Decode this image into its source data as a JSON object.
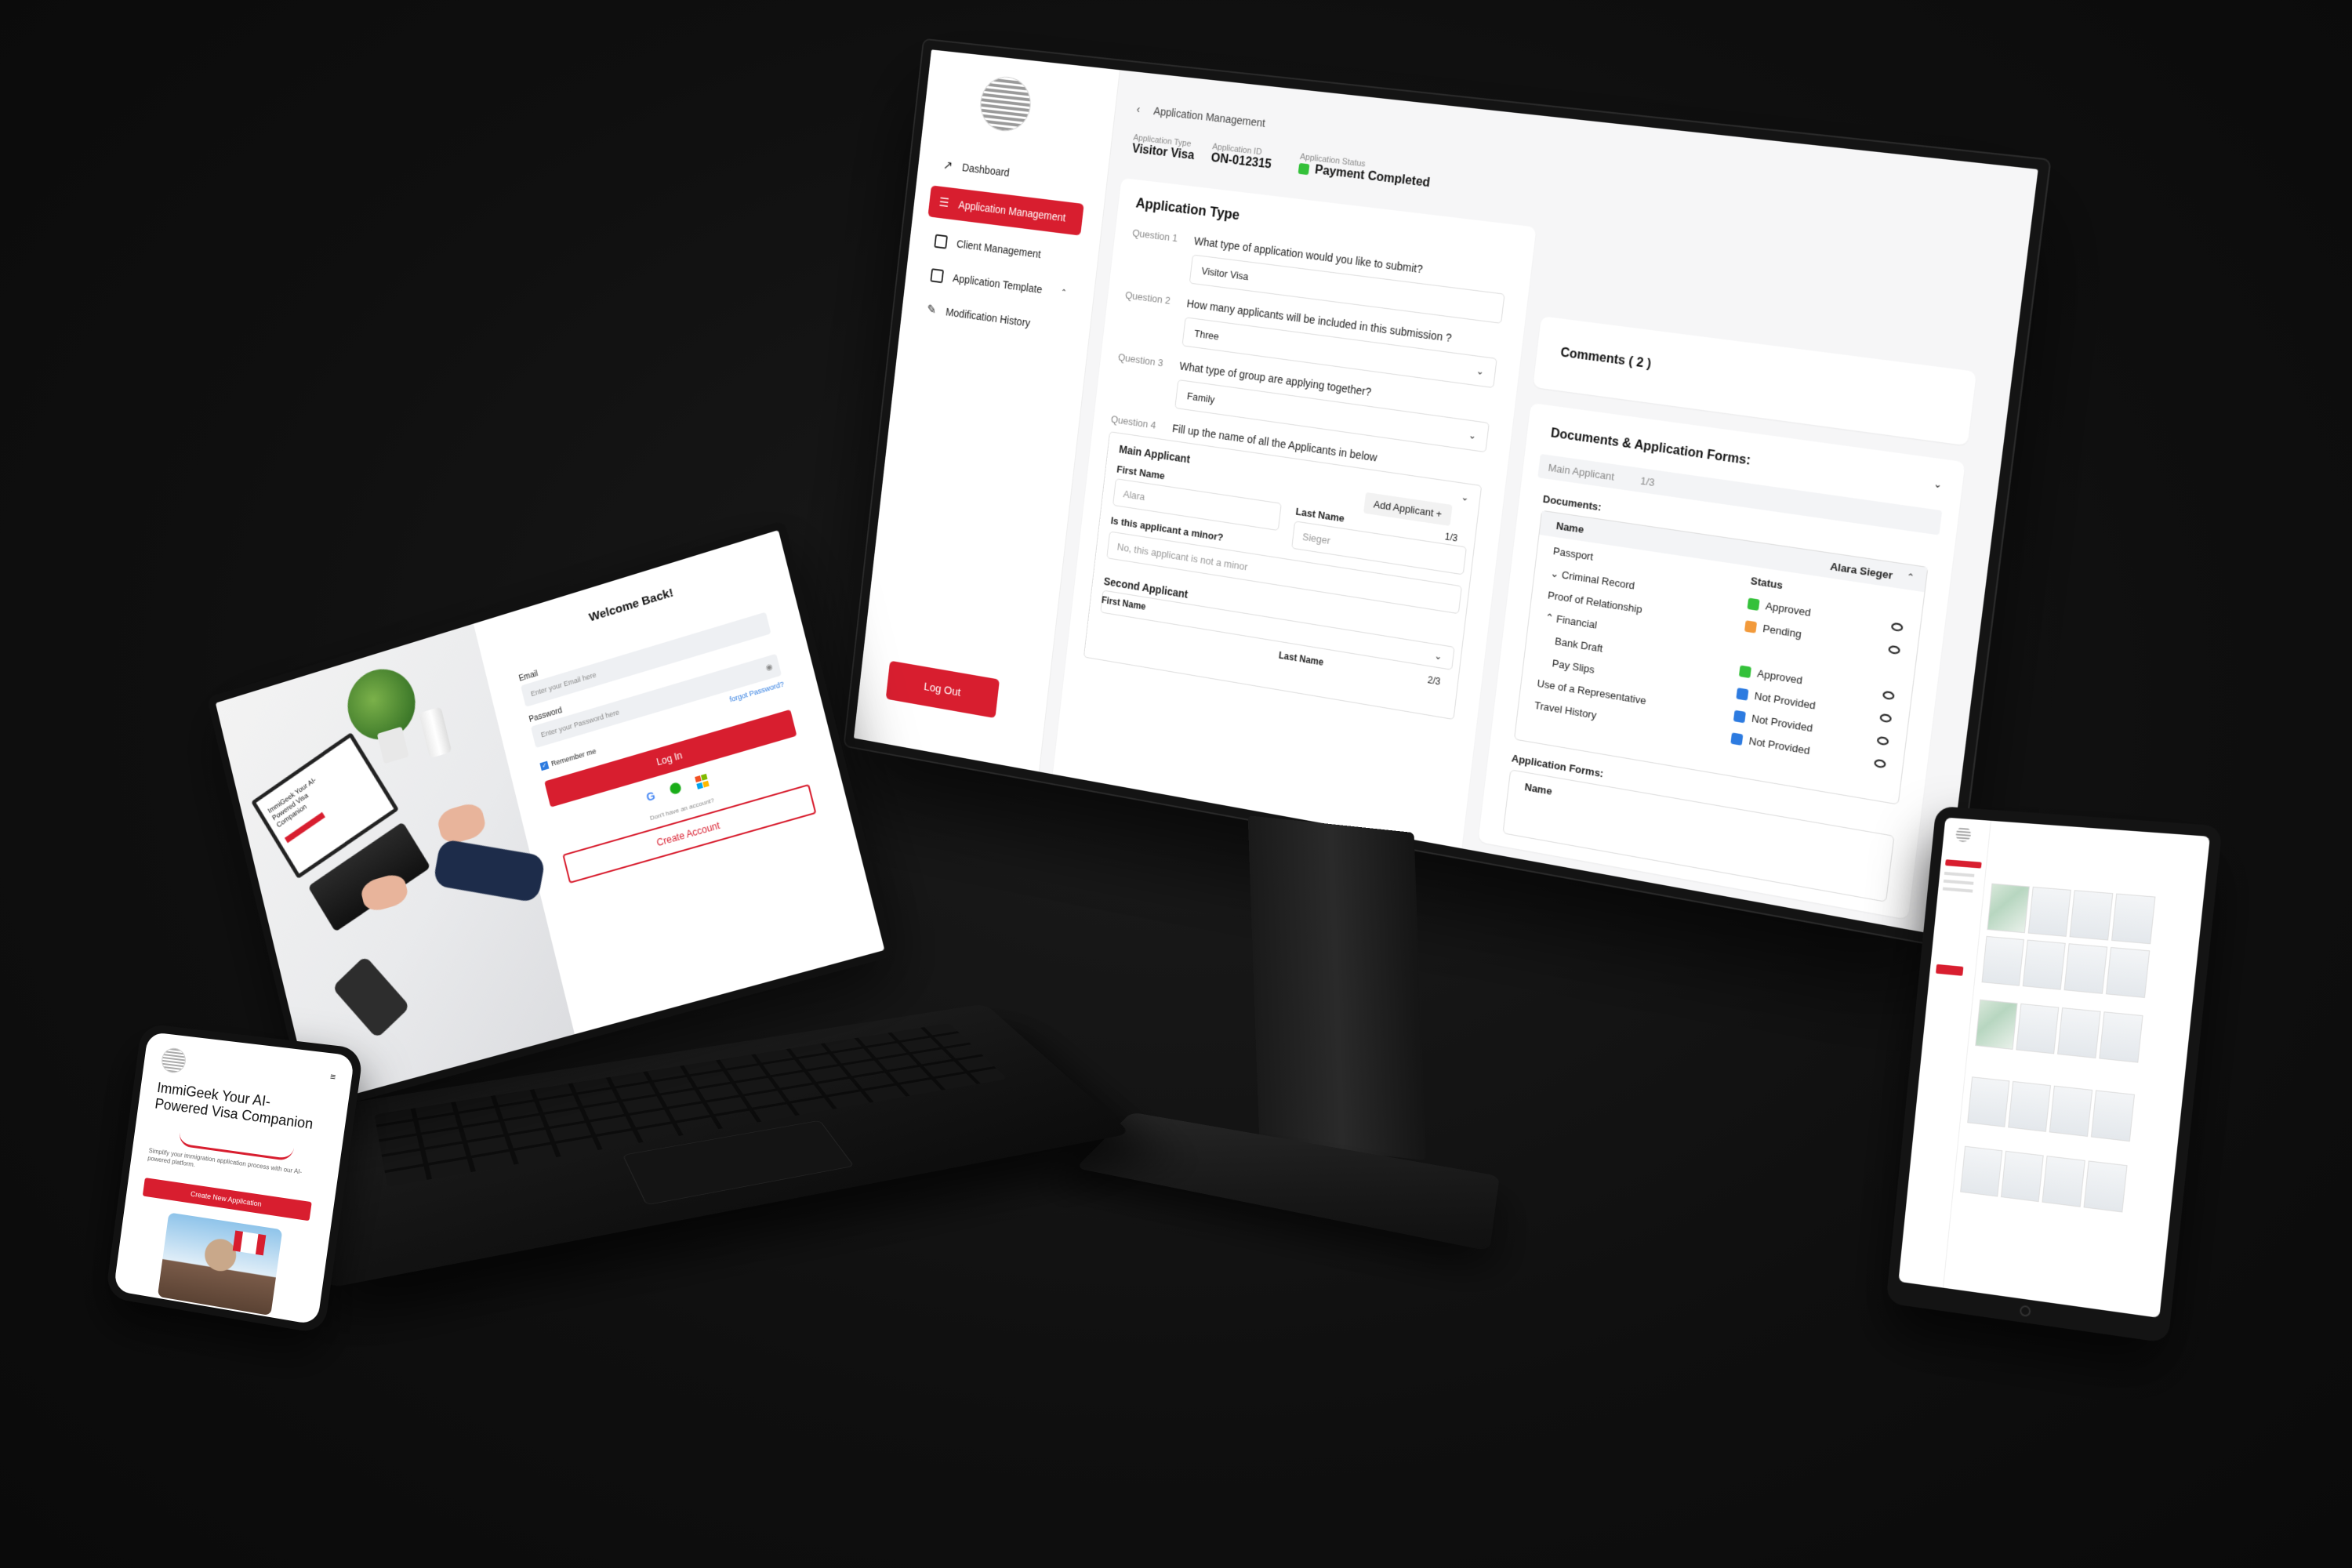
{
  "monitor": {
    "sidebar": {
      "items": [
        {
          "label": "Dashboard",
          "icon": "chart-line-icon"
        },
        {
          "label": "Application Management",
          "icon": "list-check-icon"
        },
        {
          "label": "Client Management",
          "icon": "user-card-icon"
        },
        {
          "label": "Application Template",
          "icon": "template-icon"
        },
        {
          "label": "Modification History",
          "icon": "edit-icon"
        }
      ],
      "logout_label": "Log Out"
    },
    "breadcrumb": "Application Management",
    "meta": {
      "type_label": "Application Type",
      "type_value": "Visitor Visa",
      "id_label": "Application ID",
      "id_value": "ON-012315",
      "status_label": "Application Status",
      "status_value": "Payment Completed"
    },
    "form": {
      "title": "Application Type",
      "questions": [
        {
          "label": "Question 1",
          "text": "What type of application would you like to submit?",
          "value": "Visitor Visa"
        },
        {
          "label": "Question 2",
          "text": "How many applicants will be included in this submission ?",
          "value": "Three"
        },
        {
          "label": "Question 3",
          "text": "What type of group are applying together?",
          "value": "Family"
        },
        {
          "label": "Question 4",
          "text": "Fill up the name of all the Applicants in below"
        }
      ],
      "main_applicant": "Main Applicant",
      "add_applicant": "Add Applicant +",
      "first_name_label": "First Name",
      "first_name_value": "Alara",
      "last_name_label": "Last Name",
      "last_name_value": "Sieger",
      "minor_label": "Is this applicant a minor?",
      "minor_value": "No, this applicant is not a minor",
      "page_1": "1/3",
      "second_applicant": "Second Applicant",
      "second_first_name_label": "First Name",
      "second_last_name_label": "Last Name",
      "page_2": "2/3"
    },
    "comments": {
      "title": "Comments ( 2 )"
    },
    "documents": {
      "title": "Documents & Application Forms:",
      "tab": "Main Applicant",
      "tab_count": "1/3",
      "docs_label": "Documents:",
      "col_name": "Name",
      "applicant_name": "Alara Sieger",
      "col_status": "Status",
      "rows": [
        {
          "name": "Passport"
        },
        {
          "name": "Criminal Record",
          "status": "Approved",
          "color": "#34c13a"
        },
        {
          "name": "Proof of Relationship",
          "status": "Pending",
          "color": "#f29a3b"
        },
        {
          "name": "Financial"
        },
        {
          "name": "Bank Draft",
          "status": "Approved",
          "color": "#34c13a"
        },
        {
          "name": "Pay Slips",
          "status": "Not Provided",
          "color": "#2d7be0"
        },
        {
          "name": "Use of a Representative",
          "status": "Not Provided",
          "color": "#2d7be0"
        },
        {
          "name": "Travel History",
          "status": "Not Provided",
          "color": "#2d7be0"
        }
      ],
      "forms_label": "Application Forms:",
      "forms_col_name": "Name"
    }
  },
  "laptop": {
    "title": "Welcome Back!",
    "email_label": "Email",
    "email_placeholder": "Enter your Email here",
    "password_label": "Password",
    "password_placeholder": "Enter your Password here",
    "forgot": "forgot Password?",
    "remember": "Remember me",
    "login": "Log In",
    "no_account": "Don't have an account?",
    "create": "Create Account",
    "photo_screen_text": "ImmiGeek Your AI-Powered Visa Companion"
  },
  "phone": {
    "title": "ImmiGeek Your AI-Powered Visa Companion",
    "desc": "Simplify your immigration application process with our AI-powered platform.",
    "button": "Create New Application"
  },
  "colors": {
    "brand": "#d81e2f",
    "approved": "#34c13a",
    "pending": "#f29a3b",
    "not_provided": "#2d7be0"
  }
}
